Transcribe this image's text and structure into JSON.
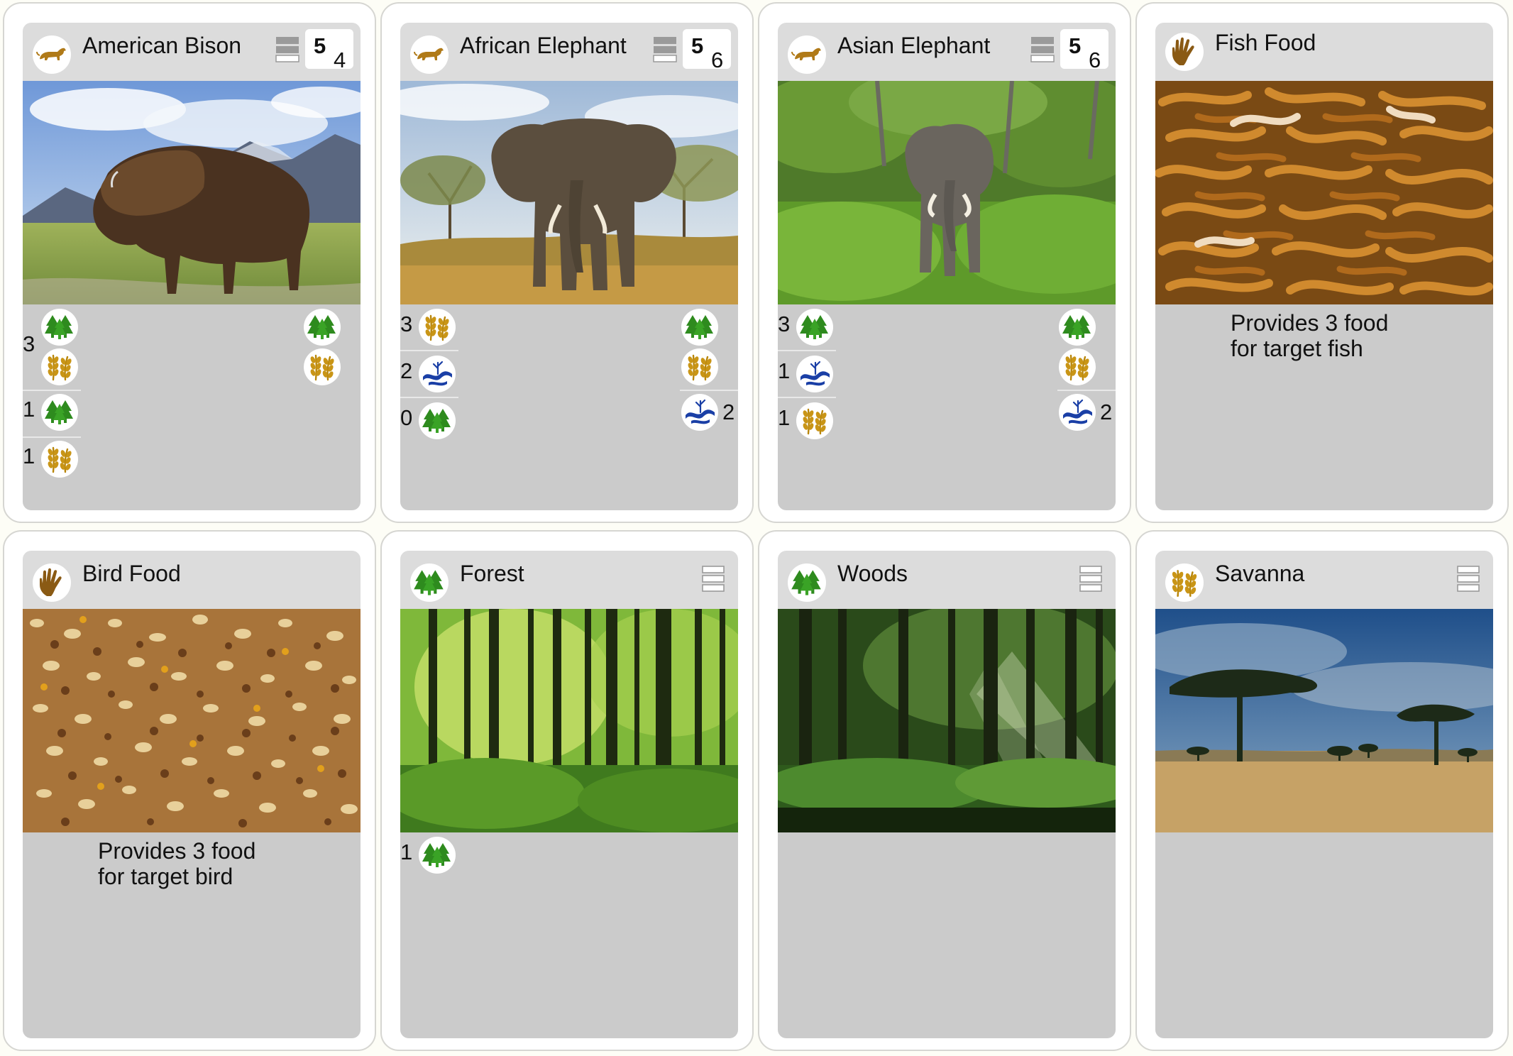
{
  "cards": [
    {
      "title": "American Bison",
      "type_icon": "animal-icon",
      "cost_a": "5",
      "cost_b": "4",
      "requirements": [
        {
          "count": "3",
          "icons": [
            "forest-icon",
            "grain-icon"
          ]
        },
        {
          "count": "1",
          "icons": [
            "forest-icon"
          ]
        },
        {
          "count": "1",
          "icons": [
            "grain-icon"
          ]
        }
      ],
      "provides": [
        {
          "icon": "forest-icon",
          "count": ""
        },
        {
          "icon": "grain-icon",
          "count": ""
        }
      ]
    },
    {
      "title": "African Elephant",
      "type_icon": "animal-icon",
      "cost_a": "5",
      "cost_b": "6",
      "requirements": [
        {
          "count": "3",
          "icons": [
            "grain-icon"
          ]
        },
        {
          "count": "2",
          "icons": [
            "water-icon"
          ]
        },
        {
          "count": "0",
          "icons": [
            "forest-icon"
          ]
        }
      ],
      "provides": [
        {
          "icon": "forest-icon",
          "count": ""
        },
        {
          "icon": "grain-icon",
          "count": ""
        },
        {
          "icon": "water-icon",
          "count": "2"
        }
      ]
    },
    {
      "title": "Asian Elephant",
      "type_icon": "animal-icon",
      "cost_a": "5",
      "cost_b": "6",
      "requirements": [
        {
          "count": "3",
          "icons": [
            "forest-icon"
          ]
        },
        {
          "count": "1",
          "icons": [
            "water-icon"
          ]
        },
        {
          "count": "1",
          "icons": [
            "grain-icon"
          ]
        }
      ],
      "provides": [
        {
          "icon": "forest-icon",
          "count": ""
        },
        {
          "icon": "grain-icon",
          "count": ""
        },
        {
          "icon": "water-icon",
          "count": "2"
        }
      ]
    },
    {
      "title": "Fish Food",
      "type_icon": "hand-icon",
      "desc1": "Provides 3 food",
      "desc2": "for target fish"
    },
    {
      "title": "Bird Food",
      "type_icon": "hand-icon",
      "desc1": "Provides 3 food",
      "desc2": "for target bird"
    },
    {
      "title": "Forest",
      "type_icon": "forest-icon",
      "requirements": [
        {
          "count": "1",
          "icons": [
            "forest-icon"
          ]
        }
      ]
    },
    {
      "title": "Woods",
      "type_icon": "forest-icon"
    },
    {
      "title": "Savanna",
      "type_icon": "grain-icon"
    }
  ],
  "colors": {
    "header": "#dcdcdc",
    "body": "#cbcbcb",
    "forest": "#2e8b1e",
    "grain": "#b8860b",
    "water": "#1a3fa6",
    "animal": "#b07a18",
    "hand": "#8a5a14"
  }
}
